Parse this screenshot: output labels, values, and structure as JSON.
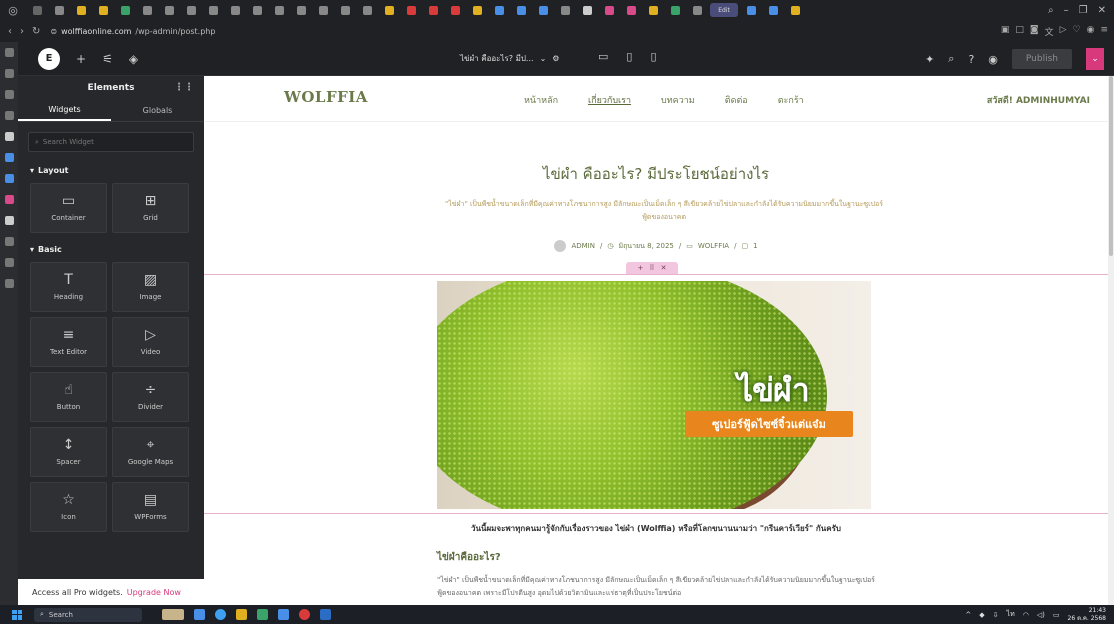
{
  "browser": {
    "url_host": "wolffiaonline.com",
    "url_path": "/wp-admin/post.php",
    "active_tab_label": "Edit"
  },
  "editor": {
    "document_title": "ไข่ผำ คืออะไร? มีป...",
    "publish_label": "Publish",
    "panel_title": "Elements",
    "tabs": [
      "Widgets",
      "Globals"
    ],
    "search_placeholder": "Search Widget",
    "layout_section": "Layout",
    "basic_section": "Basic",
    "layout_widgets": [
      {
        "label": "Container",
        "icon": "▭"
      },
      {
        "label": "Grid",
        "icon": "⊞"
      }
    ],
    "basic_widgets": [
      {
        "label": "Heading",
        "icon": "T"
      },
      {
        "label": "Image",
        "icon": "▨"
      },
      {
        "label": "Text Editor",
        "icon": "≡"
      },
      {
        "label": "Video",
        "icon": "▷"
      },
      {
        "label": "Button",
        "icon": "☝"
      },
      {
        "label": "Divider",
        "icon": "÷"
      },
      {
        "label": "Spacer",
        "icon": "↕"
      },
      {
        "label": "Google Maps",
        "icon": "⌖"
      },
      {
        "label": "Icon",
        "icon": "☆"
      },
      {
        "label": "WPForms",
        "icon": "▤"
      }
    ],
    "upgrade_text": "Access all Pro widgets.",
    "upgrade_link": "Upgrade Now"
  },
  "site": {
    "logo": "WOLFFIA",
    "nav": [
      "หน้าหลัก",
      "เกี่ยวกับเรา",
      "บทความ",
      "ติดต่อ",
      "ตะกร้า"
    ],
    "user": "สวัสดี! ADMINHUMYAI",
    "title": "ไข่ผำ คืออะไร? มีประโยชน์อย่างไร",
    "excerpt": "\"ไข่ผำ\" เป็นพืชน้ำขนาดเล็กที่มีคุณค่าทางโภชนาการสูง มีลักษณะเป็นเม็ดเล็ก ๆ สีเขียวคล้ายไข่ปลาและกำลังได้รับความนิยมมากขึ้นในฐานะซูเปอร์ฟู้ดของอนาคต",
    "meta_author": "ADMIN",
    "meta_date": "มิถุนายน 8, 2025",
    "meta_category": "WOLFFIA",
    "meta_comments": "1",
    "hero_brand": "ไข่ผำ",
    "hero_ribbon": "ซูเปอร์ฟู้ดไซซ์จิ๋วแต่แจ๋ม",
    "caption": "วันนี้ผมจะพาทุกคนมารู้จักกับเรื่องราวของ ไข่ผำ (Wolffia) หรือที่โลกขนานนามว่า \"กรีนคาร์เวียร์\" กันครับ",
    "h2": "ไข่ผำคืออะไร?",
    "body": "\"ไข่ผำ\" เป็นพืชน้ำขนาดเล็กที่มีคุณค่าทางโภชนาการสูง มีลักษณะเป็นเม็ดเล็ก ๆ สีเขียวคล้ายไข่ปลาและกำลังได้รับความนิยมมากขึ้นในฐานะซูเปอร์ฟู้ดของอนาคต เพราะมีโปรตีนสูง อุดมไปด้วยวิตามินและแร่ธาตุที่เป็นประโยชน์ต่อ"
  },
  "taskbar": {
    "search_label": "Search",
    "time": "21:43",
    "date": "26 ต.ค. 2568"
  },
  "colors": {
    "accent": "#d8387c",
    "site_green": "#5a6a3a"
  }
}
